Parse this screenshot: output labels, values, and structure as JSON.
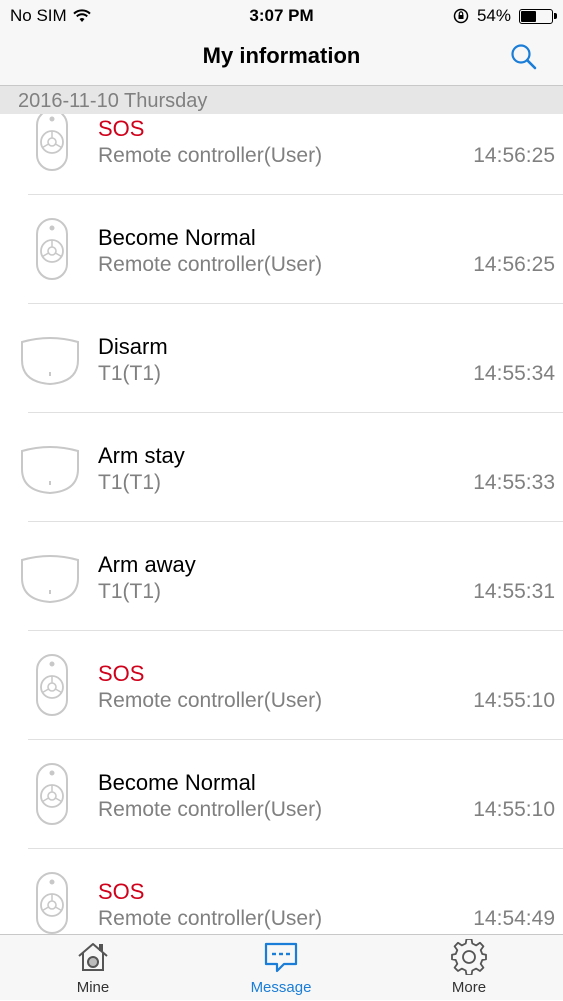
{
  "status_bar": {
    "carrier": "No SIM",
    "time": "3:07 PM",
    "battery": "54%",
    "battery_level": 0.54
  },
  "nav": {
    "title": "My information"
  },
  "section": {
    "date": "2016-11-10 Thursday"
  },
  "messages": [
    {
      "title": "SOS",
      "alert": true,
      "source": "Remote controller(User)",
      "time": "14:56:25",
      "icon": "remote-controller-icon"
    },
    {
      "title": "Become Normal",
      "alert": false,
      "source": "Remote controller(User)",
      "time": "14:56:25",
      "icon": "remote-controller-icon"
    },
    {
      "title": "Disarm",
      "alert": false,
      "source": "T1(T1)",
      "time": "14:55:34",
      "icon": "sensor-icon"
    },
    {
      "title": "Arm stay",
      "alert": false,
      "source": "T1(T1)",
      "time": "14:55:33",
      "icon": "sensor-icon"
    },
    {
      "title": "Arm away",
      "alert": false,
      "source": "T1(T1)",
      "time": "14:55:31",
      "icon": "sensor-icon"
    },
    {
      "title": "SOS",
      "alert": true,
      "source": "Remote controller(User)",
      "time": "14:55:10",
      "icon": "remote-controller-icon"
    },
    {
      "title": "Become Normal",
      "alert": false,
      "source": "Remote controller(User)",
      "time": "14:55:10",
      "icon": "remote-controller-icon"
    },
    {
      "title": "SOS",
      "alert": true,
      "source": "Remote controller(User)",
      "time": "14:54:49",
      "icon": "remote-controller-icon"
    }
  ],
  "tabs": [
    {
      "label": "Mine",
      "icon": "home-icon",
      "active": false
    },
    {
      "label": "Message",
      "icon": "message-icon",
      "active": true
    },
    {
      "label": "More",
      "icon": "gear-icon",
      "active": false
    }
  ],
  "colors": {
    "accent": "#1a7dd7",
    "alert": "#d0021b",
    "secondary_text": "#808080"
  }
}
